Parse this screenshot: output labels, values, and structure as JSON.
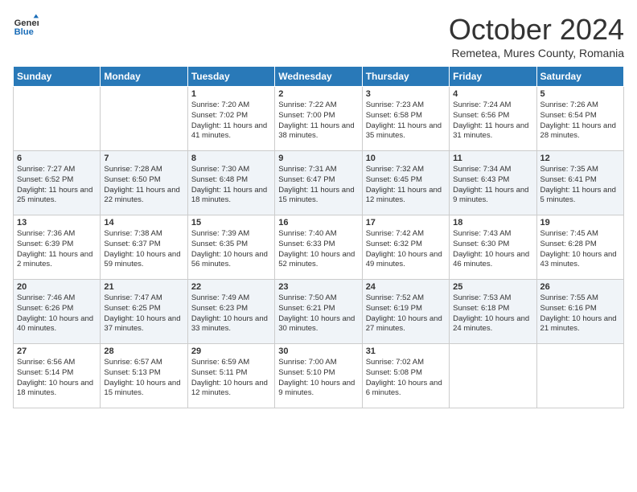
{
  "logo": {
    "general": "General",
    "blue": "Blue"
  },
  "title": "October 2024",
  "subtitle": "Remetea, Mures County, Romania",
  "days_header": [
    "Sunday",
    "Monday",
    "Tuesday",
    "Wednesday",
    "Thursday",
    "Friday",
    "Saturday"
  ],
  "weeks": [
    [
      {
        "day": "",
        "content": ""
      },
      {
        "day": "",
        "content": ""
      },
      {
        "day": "1",
        "content": "Sunrise: 7:20 AM\nSunset: 7:02 PM\nDaylight: 11 hours and 41 minutes."
      },
      {
        "day": "2",
        "content": "Sunrise: 7:22 AM\nSunset: 7:00 PM\nDaylight: 11 hours and 38 minutes."
      },
      {
        "day": "3",
        "content": "Sunrise: 7:23 AM\nSunset: 6:58 PM\nDaylight: 11 hours and 35 minutes."
      },
      {
        "day": "4",
        "content": "Sunrise: 7:24 AM\nSunset: 6:56 PM\nDaylight: 11 hours and 31 minutes."
      },
      {
        "day": "5",
        "content": "Sunrise: 7:26 AM\nSunset: 6:54 PM\nDaylight: 11 hours and 28 minutes."
      }
    ],
    [
      {
        "day": "6",
        "content": "Sunrise: 7:27 AM\nSunset: 6:52 PM\nDaylight: 11 hours and 25 minutes."
      },
      {
        "day": "7",
        "content": "Sunrise: 7:28 AM\nSunset: 6:50 PM\nDaylight: 11 hours and 22 minutes."
      },
      {
        "day": "8",
        "content": "Sunrise: 7:30 AM\nSunset: 6:48 PM\nDaylight: 11 hours and 18 minutes."
      },
      {
        "day": "9",
        "content": "Sunrise: 7:31 AM\nSunset: 6:47 PM\nDaylight: 11 hours and 15 minutes."
      },
      {
        "day": "10",
        "content": "Sunrise: 7:32 AM\nSunset: 6:45 PM\nDaylight: 11 hours and 12 minutes."
      },
      {
        "day": "11",
        "content": "Sunrise: 7:34 AM\nSunset: 6:43 PM\nDaylight: 11 hours and 9 minutes."
      },
      {
        "day": "12",
        "content": "Sunrise: 7:35 AM\nSunset: 6:41 PM\nDaylight: 11 hours and 5 minutes."
      }
    ],
    [
      {
        "day": "13",
        "content": "Sunrise: 7:36 AM\nSunset: 6:39 PM\nDaylight: 11 hours and 2 minutes."
      },
      {
        "day": "14",
        "content": "Sunrise: 7:38 AM\nSunset: 6:37 PM\nDaylight: 10 hours and 59 minutes."
      },
      {
        "day": "15",
        "content": "Sunrise: 7:39 AM\nSunset: 6:35 PM\nDaylight: 10 hours and 56 minutes."
      },
      {
        "day": "16",
        "content": "Sunrise: 7:40 AM\nSunset: 6:33 PM\nDaylight: 10 hours and 52 minutes."
      },
      {
        "day": "17",
        "content": "Sunrise: 7:42 AM\nSunset: 6:32 PM\nDaylight: 10 hours and 49 minutes."
      },
      {
        "day": "18",
        "content": "Sunrise: 7:43 AM\nSunset: 6:30 PM\nDaylight: 10 hours and 46 minutes."
      },
      {
        "day": "19",
        "content": "Sunrise: 7:45 AM\nSunset: 6:28 PM\nDaylight: 10 hours and 43 minutes."
      }
    ],
    [
      {
        "day": "20",
        "content": "Sunrise: 7:46 AM\nSunset: 6:26 PM\nDaylight: 10 hours and 40 minutes."
      },
      {
        "day": "21",
        "content": "Sunrise: 7:47 AM\nSunset: 6:25 PM\nDaylight: 10 hours and 37 minutes."
      },
      {
        "day": "22",
        "content": "Sunrise: 7:49 AM\nSunset: 6:23 PM\nDaylight: 10 hours and 33 minutes."
      },
      {
        "day": "23",
        "content": "Sunrise: 7:50 AM\nSunset: 6:21 PM\nDaylight: 10 hours and 30 minutes."
      },
      {
        "day": "24",
        "content": "Sunrise: 7:52 AM\nSunset: 6:19 PM\nDaylight: 10 hours and 27 minutes."
      },
      {
        "day": "25",
        "content": "Sunrise: 7:53 AM\nSunset: 6:18 PM\nDaylight: 10 hours and 24 minutes."
      },
      {
        "day": "26",
        "content": "Sunrise: 7:55 AM\nSunset: 6:16 PM\nDaylight: 10 hours and 21 minutes."
      }
    ],
    [
      {
        "day": "27",
        "content": "Sunrise: 6:56 AM\nSunset: 5:14 PM\nDaylight: 10 hours and 18 minutes."
      },
      {
        "day": "28",
        "content": "Sunrise: 6:57 AM\nSunset: 5:13 PM\nDaylight: 10 hours and 15 minutes."
      },
      {
        "day": "29",
        "content": "Sunrise: 6:59 AM\nSunset: 5:11 PM\nDaylight: 10 hours and 12 minutes."
      },
      {
        "day": "30",
        "content": "Sunrise: 7:00 AM\nSunset: 5:10 PM\nDaylight: 10 hours and 9 minutes."
      },
      {
        "day": "31",
        "content": "Sunrise: 7:02 AM\nSunset: 5:08 PM\nDaylight: 10 hours and 6 minutes."
      },
      {
        "day": "",
        "content": ""
      },
      {
        "day": "",
        "content": ""
      }
    ]
  ]
}
